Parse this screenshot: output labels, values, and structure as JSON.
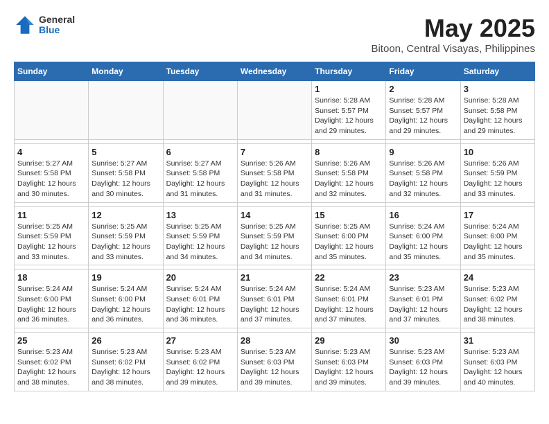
{
  "header": {
    "logo_general": "General",
    "logo_blue": "Blue",
    "title": "May 2025",
    "subtitle": "Bitoon, Central Visayas, Philippines"
  },
  "weekdays": [
    "Sunday",
    "Monday",
    "Tuesday",
    "Wednesday",
    "Thursday",
    "Friday",
    "Saturday"
  ],
  "weeks": [
    [
      {
        "day": "",
        "info": ""
      },
      {
        "day": "",
        "info": ""
      },
      {
        "day": "",
        "info": ""
      },
      {
        "day": "",
        "info": ""
      },
      {
        "day": "1",
        "info": "Sunrise: 5:28 AM\nSunset: 5:57 PM\nDaylight: 12 hours\nand 29 minutes."
      },
      {
        "day": "2",
        "info": "Sunrise: 5:28 AM\nSunset: 5:57 PM\nDaylight: 12 hours\nand 29 minutes."
      },
      {
        "day": "3",
        "info": "Sunrise: 5:28 AM\nSunset: 5:58 PM\nDaylight: 12 hours\nand 29 minutes."
      }
    ],
    [
      {
        "day": "4",
        "info": "Sunrise: 5:27 AM\nSunset: 5:58 PM\nDaylight: 12 hours\nand 30 minutes."
      },
      {
        "day": "5",
        "info": "Sunrise: 5:27 AM\nSunset: 5:58 PM\nDaylight: 12 hours\nand 30 minutes."
      },
      {
        "day": "6",
        "info": "Sunrise: 5:27 AM\nSunset: 5:58 PM\nDaylight: 12 hours\nand 31 minutes."
      },
      {
        "day": "7",
        "info": "Sunrise: 5:26 AM\nSunset: 5:58 PM\nDaylight: 12 hours\nand 31 minutes."
      },
      {
        "day": "8",
        "info": "Sunrise: 5:26 AM\nSunset: 5:58 PM\nDaylight: 12 hours\nand 32 minutes."
      },
      {
        "day": "9",
        "info": "Sunrise: 5:26 AM\nSunset: 5:58 PM\nDaylight: 12 hours\nand 32 minutes."
      },
      {
        "day": "10",
        "info": "Sunrise: 5:26 AM\nSunset: 5:59 PM\nDaylight: 12 hours\nand 33 minutes."
      }
    ],
    [
      {
        "day": "11",
        "info": "Sunrise: 5:25 AM\nSunset: 5:59 PM\nDaylight: 12 hours\nand 33 minutes."
      },
      {
        "day": "12",
        "info": "Sunrise: 5:25 AM\nSunset: 5:59 PM\nDaylight: 12 hours\nand 33 minutes."
      },
      {
        "day": "13",
        "info": "Sunrise: 5:25 AM\nSunset: 5:59 PM\nDaylight: 12 hours\nand 34 minutes."
      },
      {
        "day": "14",
        "info": "Sunrise: 5:25 AM\nSunset: 5:59 PM\nDaylight: 12 hours\nand 34 minutes."
      },
      {
        "day": "15",
        "info": "Sunrise: 5:25 AM\nSunset: 6:00 PM\nDaylight: 12 hours\nand 35 minutes."
      },
      {
        "day": "16",
        "info": "Sunrise: 5:24 AM\nSunset: 6:00 PM\nDaylight: 12 hours\nand 35 minutes."
      },
      {
        "day": "17",
        "info": "Sunrise: 5:24 AM\nSunset: 6:00 PM\nDaylight: 12 hours\nand 35 minutes."
      }
    ],
    [
      {
        "day": "18",
        "info": "Sunrise: 5:24 AM\nSunset: 6:00 PM\nDaylight: 12 hours\nand 36 minutes."
      },
      {
        "day": "19",
        "info": "Sunrise: 5:24 AM\nSunset: 6:00 PM\nDaylight: 12 hours\nand 36 minutes."
      },
      {
        "day": "20",
        "info": "Sunrise: 5:24 AM\nSunset: 6:01 PM\nDaylight: 12 hours\nand 36 minutes."
      },
      {
        "day": "21",
        "info": "Sunrise: 5:24 AM\nSunset: 6:01 PM\nDaylight: 12 hours\nand 37 minutes."
      },
      {
        "day": "22",
        "info": "Sunrise: 5:24 AM\nSunset: 6:01 PM\nDaylight: 12 hours\nand 37 minutes."
      },
      {
        "day": "23",
        "info": "Sunrise: 5:23 AM\nSunset: 6:01 PM\nDaylight: 12 hours\nand 37 minutes."
      },
      {
        "day": "24",
        "info": "Sunrise: 5:23 AM\nSunset: 6:02 PM\nDaylight: 12 hours\nand 38 minutes."
      }
    ],
    [
      {
        "day": "25",
        "info": "Sunrise: 5:23 AM\nSunset: 6:02 PM\nDaylight: 12 hours\nand 38 minutes."
      },
      {
        "day": "26",
        "info": "Sunrise: 5:23 AM\nSunset: 6:02 PM\nDaylight: 12 hours\nand 38 minutes."
      },
      {
        "day": "27",
        "info": "Sunrise: 5:23 AM\nSunset: 6:02 PM\nDaylight: 12 hours\nand 39 minutes."
      },
      {
        "day": "28",
        "info": "Sunrise: 5:23 AM\nSunset: 6:03 PM\nDaylight: 12 hours\nand 39 minutes."
      },
      {
        "day": "29",
        "info": "Sunrise: 5:23 AM\nSunset: 6:03 PM\nDaylight: 12 hours\nand 39 minutes."
      },
      {
        "day": "30",
        "info": "Sunrise: 5:23 AM\nSunset: 6:03 PM\nDaylight: 12 hours\nand 39 minutes."
      },
      {
        "day": "31",
        "info": "Sunrise: 5:23 AM\nSunset: 6:03 PM\nDaylight: 12 hours\nand 40 minutes."
      }
    ]
  ]
}
